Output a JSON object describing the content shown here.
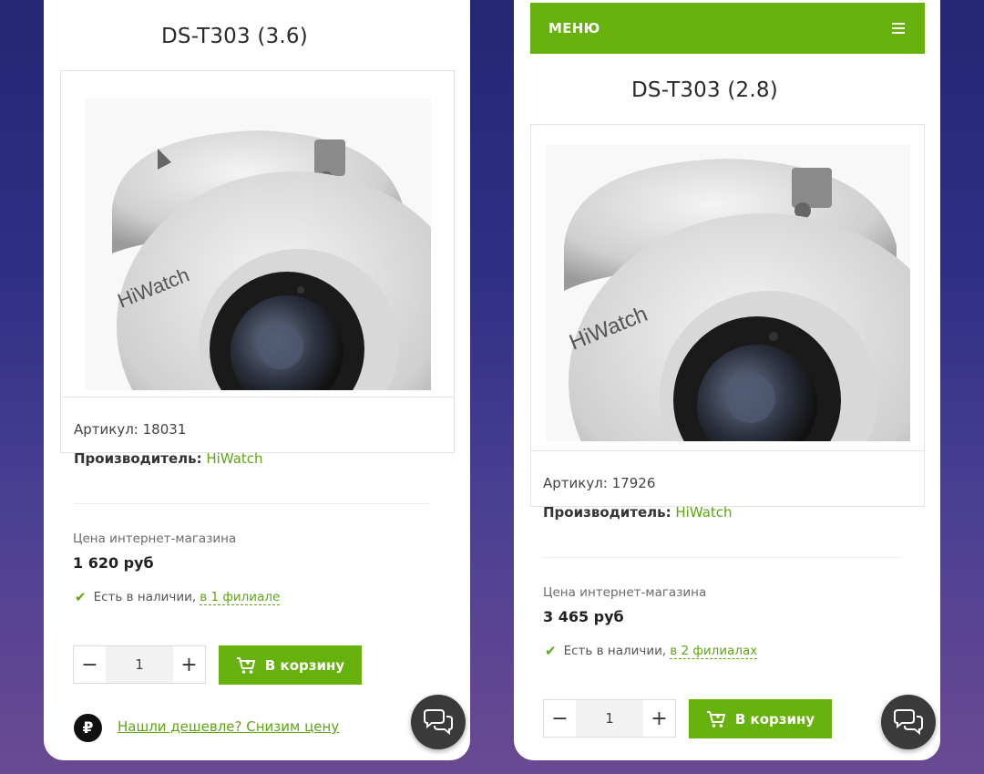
{
  "products": [
    {
      "title": "DS-T303 (3.6)",
      "article_label": "Артикул:",
      "article": "18031",
      "maker_label": "Производитель:",
      "maker": "HiWatch",
      "price_label": "Цена интернет-магазина",
      "price": "1 620 руб",
      "stock_text": "Есть в наличии,",
      "stock_link": "в 1 филиале",
      "qty_minus": "−",
      "qty_value": "1",
      "qty_plus": "+",
      "cart_label": "В корзину",
      "cheaper_link": "Нашли дешевле? Снизим цену",
      "ruble_symbol": "₽"
    },
    {
      "title": "DS-T303 (2.8)",
      "article_label": "Артикул:",
      "article": "17926",
      "maker_label": "Производитель:",
      "maker": "HiWatch",
      "price_label": "Цена интернет-магазина",
      "price": "3 465 руб",
      "stock_text": "Есть в наличии,",
      "stock_link": "в 2 филиалах",
      "qty_minus": "−",
      "qty_value": "1",
      "qty_plus": "+",
      "cart_label": "В корзину"
    }
  ],
  "menu": {
    "label": "МЕНЮ",
    "icon": "hamburger-icon"
  },
  "colors": {
    "accent": "#66b10b",
    "link": "#5ea614",
    "chat": "#3a3a3a"
  },
  "camera_logo": "HiWatch",
  "icons": {
    "chat": "chat-bubbles-icon",
    "cart": "cart-icon",
    "check": "check-icon"
  }
}
